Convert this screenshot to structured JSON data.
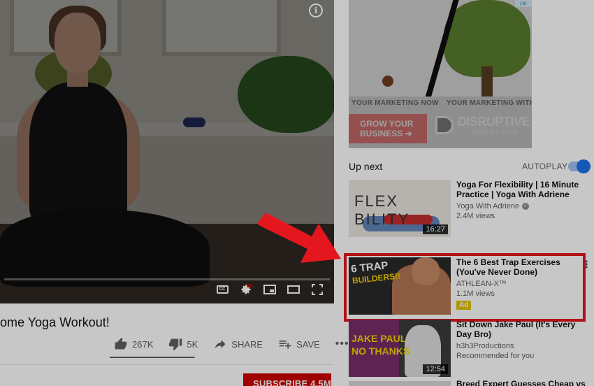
{
  "player": {
    "info_label": "i",
    "cc_label": "CC"
  },
  "video": {
    "title": "ome Yoga Workout!",
    "likes": "267K",
    "dislikes": "5K",
    "share_label": "SHARE",
    "save_label": "SAVE",
    "like_ratio": 0.98,
    "subscribe_label": "SUBSCRIBE  4.5M"
  },
  "ad_banner": {
    "choices_label": "ⅰ✕",
    "caption_left": "YOUR MARKETING NOW",
    "caption_right": "YOUR MARKETING WITH",
    "cta": "GROW YOUR BUSINESS ➔",
    "brand": "DISRUPTIVE",
    "brand_sub": "ADVERTISING"
  },
  "up_next": {
    "heading": "Up next",
    "autoplay_label": "AUTOPLAY",
    "autoplay_on": true,
    "videos": [
      {
        "title": "Yoga For Flexibility | 16 Minute Practice | Yoga With Adriene",
        "channel": "Yoga With Adriene",
        "views": "2.4M views",
        "duration": "16:27",
        "thumb_text": "FLEX BILITY"
      },
      {
        "title": "The 6 Best Trap Exercises (You've Never Done)",
        "channel": "ATHLEAN-X™",
        "views": "1.1M views",
        "badge": "Ad",
        "thumb_text": "6 TRAP",
        "thumb_sub": "BUILDERS!!"
      },
      {
        "title": "Sit Down Jake Paul (It's Every Day Bro)",
        "channel": "h3h3Productions",
        "views": "Recommended for you",
        "duration": "12:54",
        "thumb_text": "JAKE PAUL",
        "thumb_sub": "NO THANKS"
      },
      {
        "title": "Breed Expert Guesses Cheap vs"
      }
    ]
  },
  "colors": {
    "highlight": "#e4171e",
    "subscribe": "#cc0000",
    "toggle": "#1a73e8",
    "ad_badge": "#e6c200"
  }
}
